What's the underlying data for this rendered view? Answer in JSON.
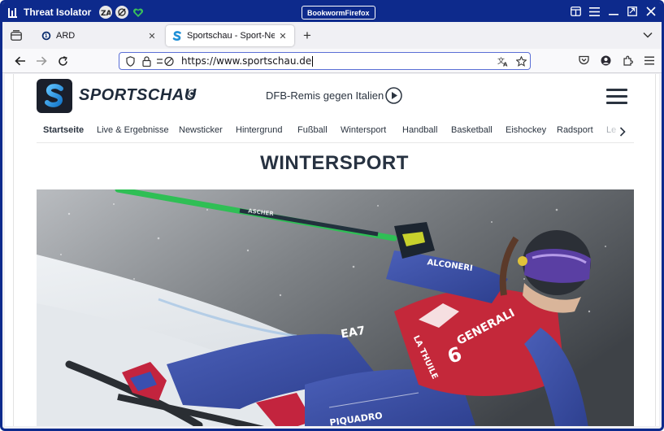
{
  "titlebar": {
    "app_title": "Threat Isolator",
    "browser_badge": "BookwormFirefox",
    "status_icons": [
      "za-shield-icon",
      "strikethrough-circle-icon",
      "green-heart-icon"
    ],
    "window_controls": [
      "sidebar-icon",
      "menu-icon",
      "minimize-icon",
      "restore-icon",
      "close-icon"
    ]
  },
  "tabs": [
    {
      "label": "ARD",
      "favicon": "ard-icon",
      "active": false
    },
    {
      "label": "Sportschau - Sport-News, E",
      "favicon": "sportschau-icon",
      "active": true
    }
  ],
  "navbar": {
    "url": "https://www.sportschau.de",
    "left_icons": [
      "back-icon",
      "forward-icon",
      "reload-icon"
    ],
    "url_icons": [
      "shield-icon",
      "lock-icon",
      "permissions-icon"
    ],
    "url_right_icons": [
      "translate-icon",
      "bookmark-star-icon"
    ],
    "tool_icons": [
      "pocket-icon",
      "account-icon",
      "extensions-icon",
      "hamburger-menu-icon"
    ]
  },
  "site": {
    "logo_text": "SPORTSCHAU",
    "headline": "DFB-Remis gegen Italien",
    "nav_items": [
      "Startseite",
      "Live & Ergebnisse",
      "Newsticker",
      "Hintergrund",
      "Fußball",
      "Wintersport",
      "Handball",
      "Basketball",
      "Eishockey",
      "Radsport",
      "Le"
    ],
    "active_nav": "Startseite",
    "section_title": "WINTERSPORT",
    "hero": {
      "bib_number": "6",
      "sponsor_text": "GENERALI",
      "sponsor2": "LA THUILE",
      "brand_suit": "EA7",
      "brand_leg": "PIQUADRO",
      "brand_sleeve": "ALCONERI",
      "pole_text": "ASCHER"
    }
  },
  "colors": {
    "titlebar": "#0d2a8c",
    "url_focus": "#5b6fd6",
    "site_text": "#273241"
  }
}
